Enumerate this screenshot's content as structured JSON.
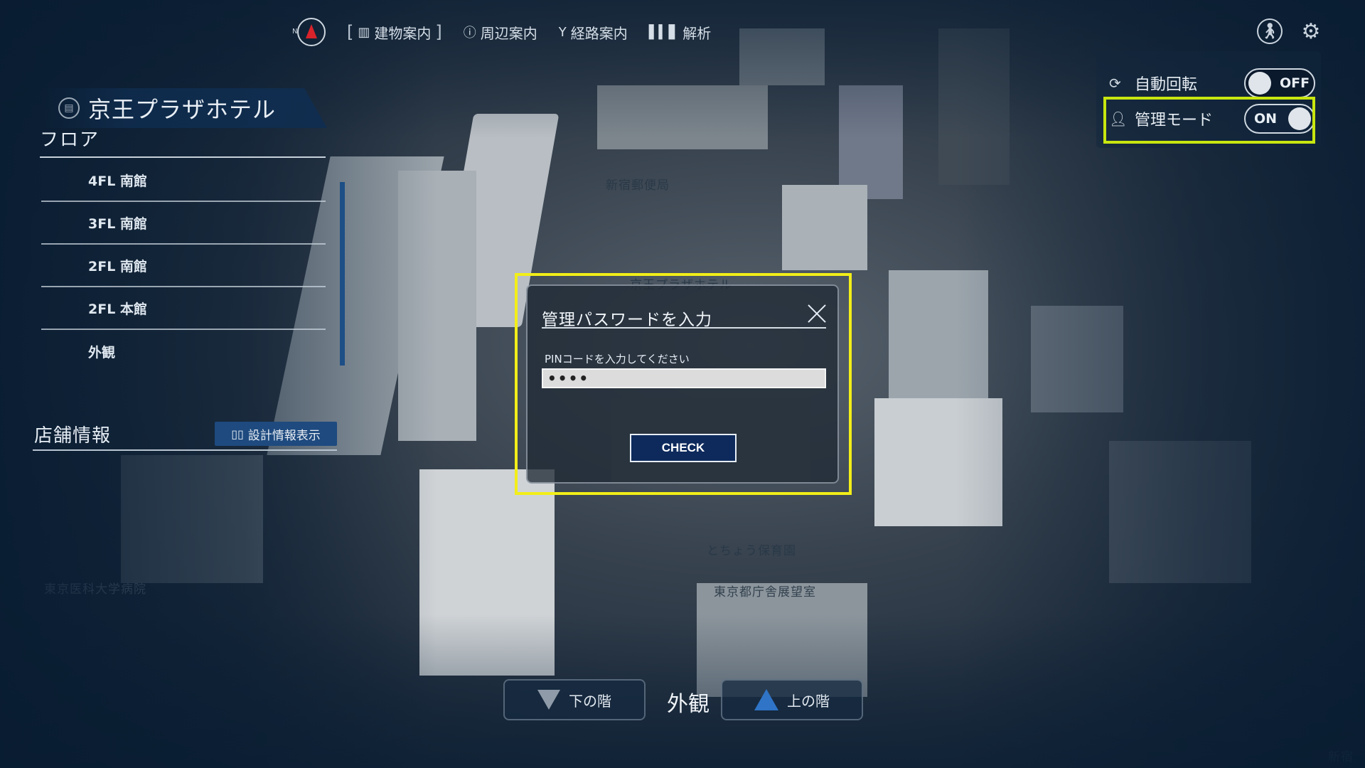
{
  "top_nav": {
    "compass_label": "N",
    "items": [
      {
        "icon": "building-icon",
        "label": "建物案内",
        "bracketed": true
      },
      {
        "icon": "info-icon",
        "label": "周辺案内"
      },
      {
        "icon": "route-icon",
        "label": "経路案内"
      },
      {
        "icon": "analytics-icon",
        "label": "解析"
      }
    ],
    "walk_icon": "walking-person-icon",
    "gear_icon": "gear-icon"
  },
  "settings_panel": {
    "auto_rotate": {
      "label": "自動回転",
      "state": "OFF",
      "icon": "rotate-camera-icon"
    },
    "admin_mode": {
      "label": "管理モード",
      "state": "ON",
      "icon": "admin-user-icon"
    }
  },
  "building": {
    "name": "京王プラザホテル",
    "icon": "building-circle-icon"
  },
  "floor_section": {
    "heading": "フロア",
    "floors": [
      "4FL 南館",
      "3FL 南館",
      "2FL 南館",
      "2FL 本館",
      "外観"
    ]
  },
  "shop_section": {
    "heading": "店舗情報",
    "design_info_button": "設計情報表示"
  },
  "map_labels": {
    "post_office": "新宿郵便局",
    "hotel": "京王プラザホテル",
    "nursery": "とちょう保育園",
    "observatory": "東京都庁舎展望室",
    "hospital": "東京医科大学病院",
    "corner": "新宿"
  },
  "floor_switcher": {
    "down_label": "下の階",
    "current": "外観",
    "up_label": "上の階"
  },
  "modal": {
    "title": "管理パスワードを入力",
    "pin_label": "PINコードを入力してください",
    "pin_value": "••••",
    "check_label": "CHECK"
  },
  "colors": {
    "highlight_yellow": "#f2ee18",
    "highlight_green": "#c8e60f",
    "accent_blue": "#1e4a7f",
    "check_button": "#0e2a5c",
    "compass_red": "#d8232a"
  }
}
